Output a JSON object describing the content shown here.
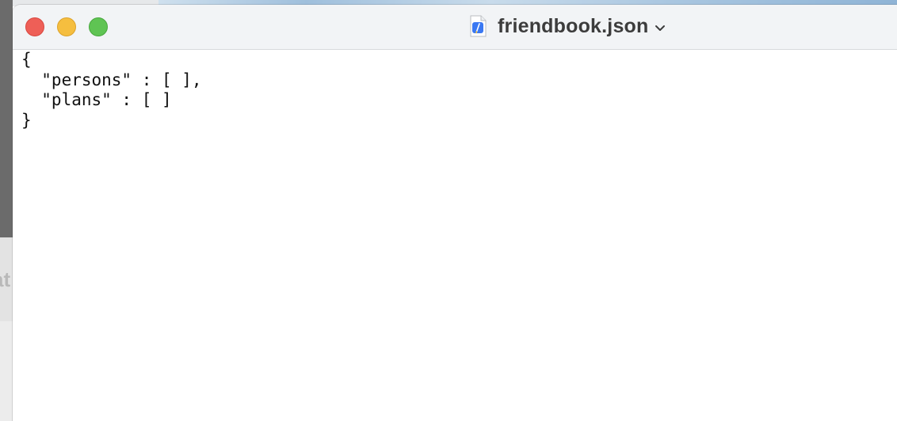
{
  "window": {
    "title": "friendbook.json",
    "icons": {
      "document": "text-document-icon",
      "title_menu": "chevron-down-icon"
    },
    "controls": {
      "close": "close-icon",
      "minimize": "minimize-icon",
      "zoom": "zoom-icon"
    }
  },
  "editor": {
    "lines": [
      "{",
      "  \"persons\" : [ ],",
      "  \"plans\" : [ ]",
      "}"
    ]
  },
  "background": {
    "partial_text": "at"
  },
  "colors": {
    "close": "#ee5f57",
    "minimize": "#f5be3f",
    "zoom": "#5fc453",
    "document_icon_accent": "#3a78f2"
  }
}
